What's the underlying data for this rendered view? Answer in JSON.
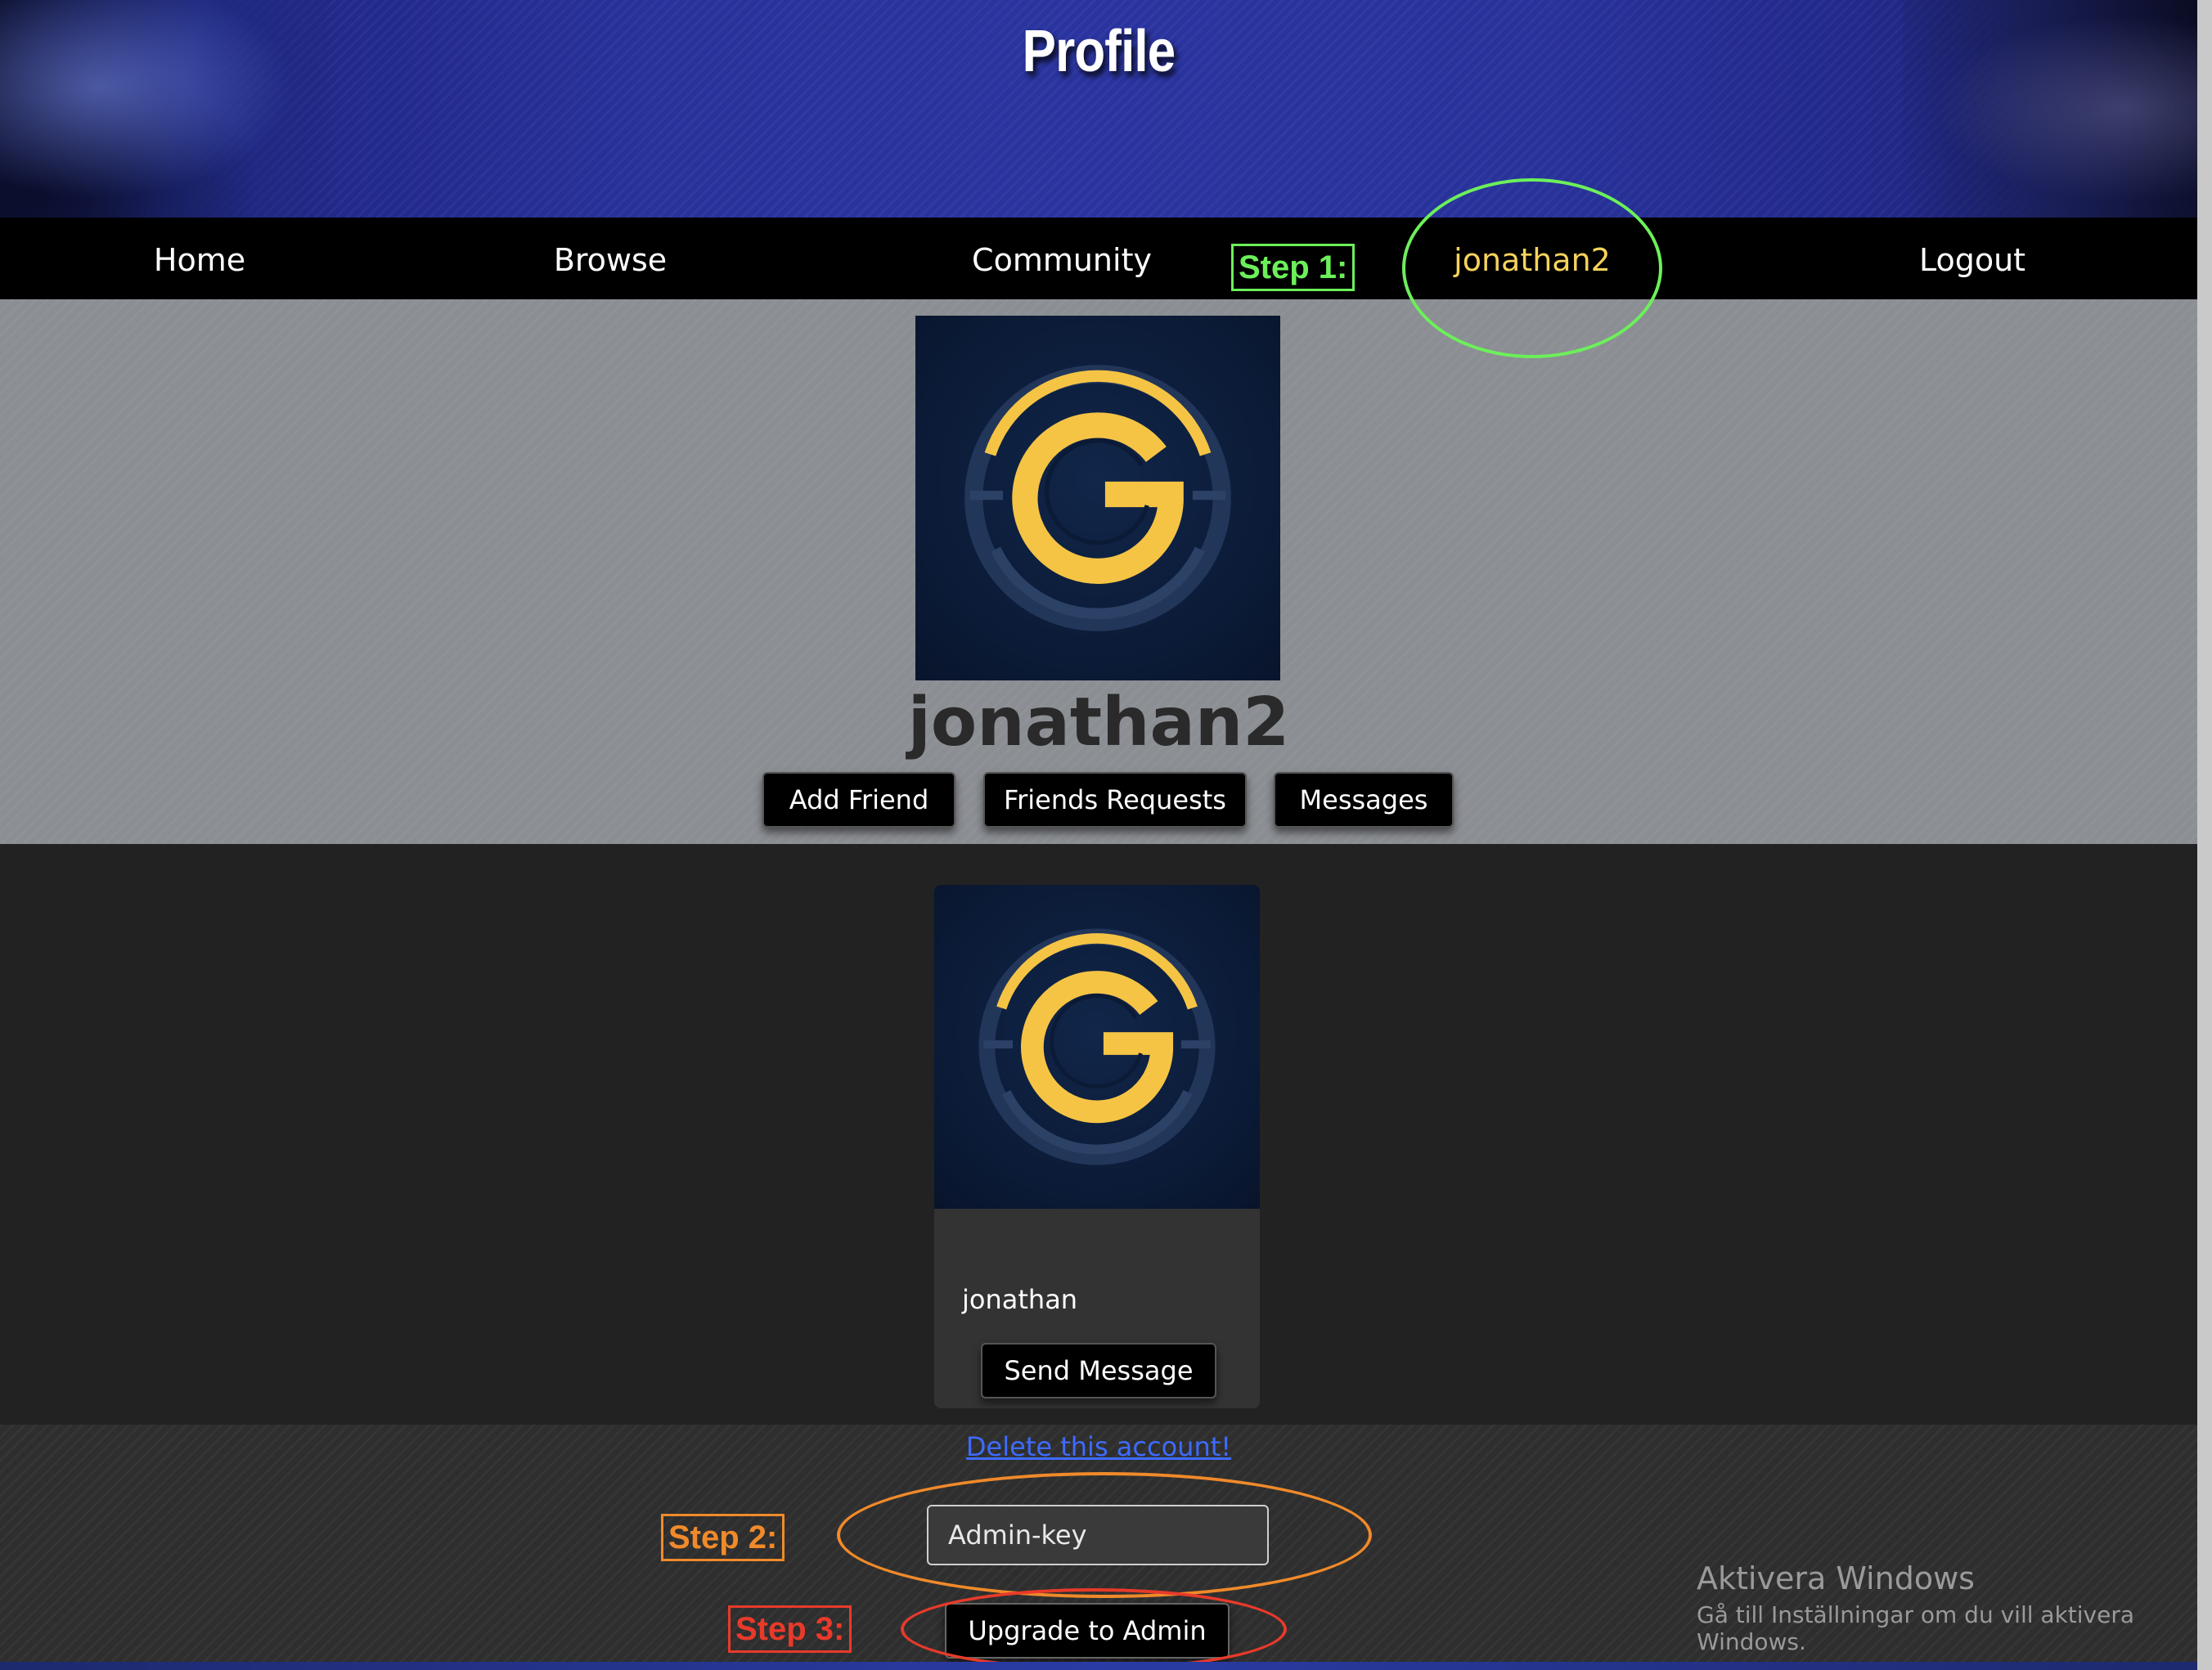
{
  "header": {
    "title": "Profile"
  },
  "nav": {
    "items": [
      "Home",
      "Browse",
      "Community",
      "jonathan2",
      "Logout"
    ],
    "active": "jonathan2"
  },
  "profile": {
    "username": "jonathan2",
    "avatar_icon": "g-logo-icon",
    "buttons": {
      "add_friend": "Add Friend",
      "friend_requests": "Friends Requests",
      "messages": "Messages"
    }
  },
  "friends": [
    {
      "name": "jonathan",
      "avatar_icon": "g-logo-icon",
      "send_message_label": "Send Message"
    }
  ],
  "account": {
    "delete_link": "Delete this account!",
    "admin_key_placeholder": "Admin-key",
    "upgrade_button": "Upgrade to Admin"
  },
  "annotations": {
    "step1": {
      "label": "Step 1:",
      "color": "#6cf05a"
    },
    "step2": {
      "label": "Step 2:",
      "color": "#f08a2a"
    },
    "step3": {
      "label": "Step 3:",
      "color": "#e83a2a"
    }
  },
  "watermark": {
    "title": "Aktivera Windows",
    "subtitle": "Gå till Inställningar om du vill aktivera Windows."
  },
  "colors": {
    "nav_active": "#f6d35b",
    "logo_gold": "#f5c445",
    "logo_bg": "#0b1a35",
    "link": "#3d6bff"
  }
}
